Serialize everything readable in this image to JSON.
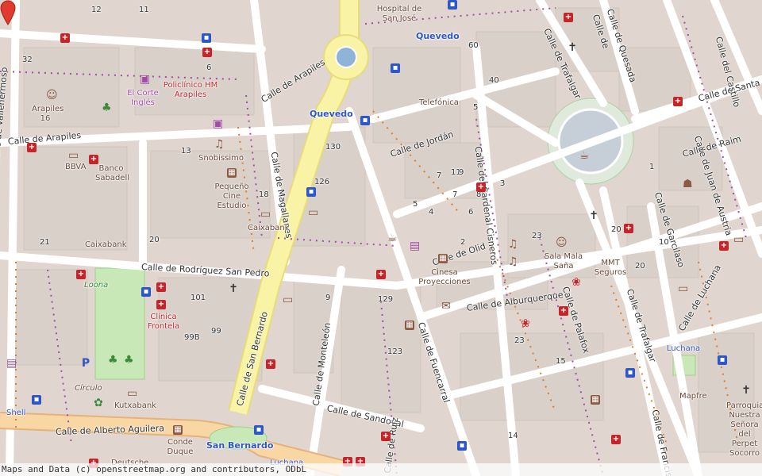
{
  "map": {
    "attribution": "Maps and Data (c) openstreetmap.org and contributors, ODbL",
    "colors": {
      "background": "#e0d6cf",
      "road_white": "#ffffff",
      "road_primary": "#f8f3a5",
      "road_secondary": "#f9d7a5",
      "park": "#c8e8b8",
      "marker": "#e03b2c"
    },
    "marker_name": "location-pin-icon",
    "streets": [
      "Calle de Arapiles",
      "Calle de Arapiles",
      "Calle de Magallanes",
      "Calle de Vallehermoso",
      "Calle de Rodríguez San Pedro",
      "Calle de San Bernardo",
      "Calle de Monteleón",
      "Calle de Sandoval",
      "Calle de Alberto Aguilera",
      "Calle de Ruiz",
      "Calle de Fuencarral",
      "Calle de Olid",
      "Calle de Alburquerque",
      "Calle de Jordán",
      "Calle del Cardenal Cisneros",
      "Calle de Trafalgar",
      "Calle de Palafox",
      "Calle de Trafalgar",
      "Calle de Francisco",
      "Calle de Luchana",
      "Calle de Garcilaso",
      "Calle de Juan de Austria",
      "Calle de Quesada",
      "Calle de Santa Fe",
      "Calle de Raim",
      "Calle del Castillo",
      "Calle de"
    ],
    "places": [
      "Hospital de San José",
      "Quevedo",
      "Telefónica",
      "El Corte Inglés",
      "Policlínico HM Arapiles",
      "Arapiles 16",
      "BBVA",
      "Banco Sabadell",
      "Snobissimo",
      "Pequeño Cine Estudio",
      "Caixabank",
      "Caixabank",
      "Loona",
      "Clínica Frontela",
      "Círculo",
      "Kutxabank",
      "Shell",
      "Conde Duque",
      "San Bernardo",
      "Deutsche",
      "Cinesa Proyecciones",
      "Sala Mala Saña",
      "MMT Seguros",
      "Luchana",
      "Mapfre",
      "Parroquia Nuestra Señora del Perpet Socorro",
      "Quevedo",
      "Luchana"
    ],
    "house_numbers": [
      "12",
      "11",
      "32",
      "6",
      "13",
      "18",
      "126",
      "130",
      "101",
      "99",
      "99B",
      "20",
      "21",
      "9",
      "129",
      "123",
      "60",
      "40",
      "23",
      "15",
      "5",
      "10",
      "11",
      "4",
      "5",
      "7",
      "9",
      "1",
      "2",
      "3",
      "6",
      "7",
      "8",
      "23",
      "20",
      "20",
      "14"
    ]
  }
}
